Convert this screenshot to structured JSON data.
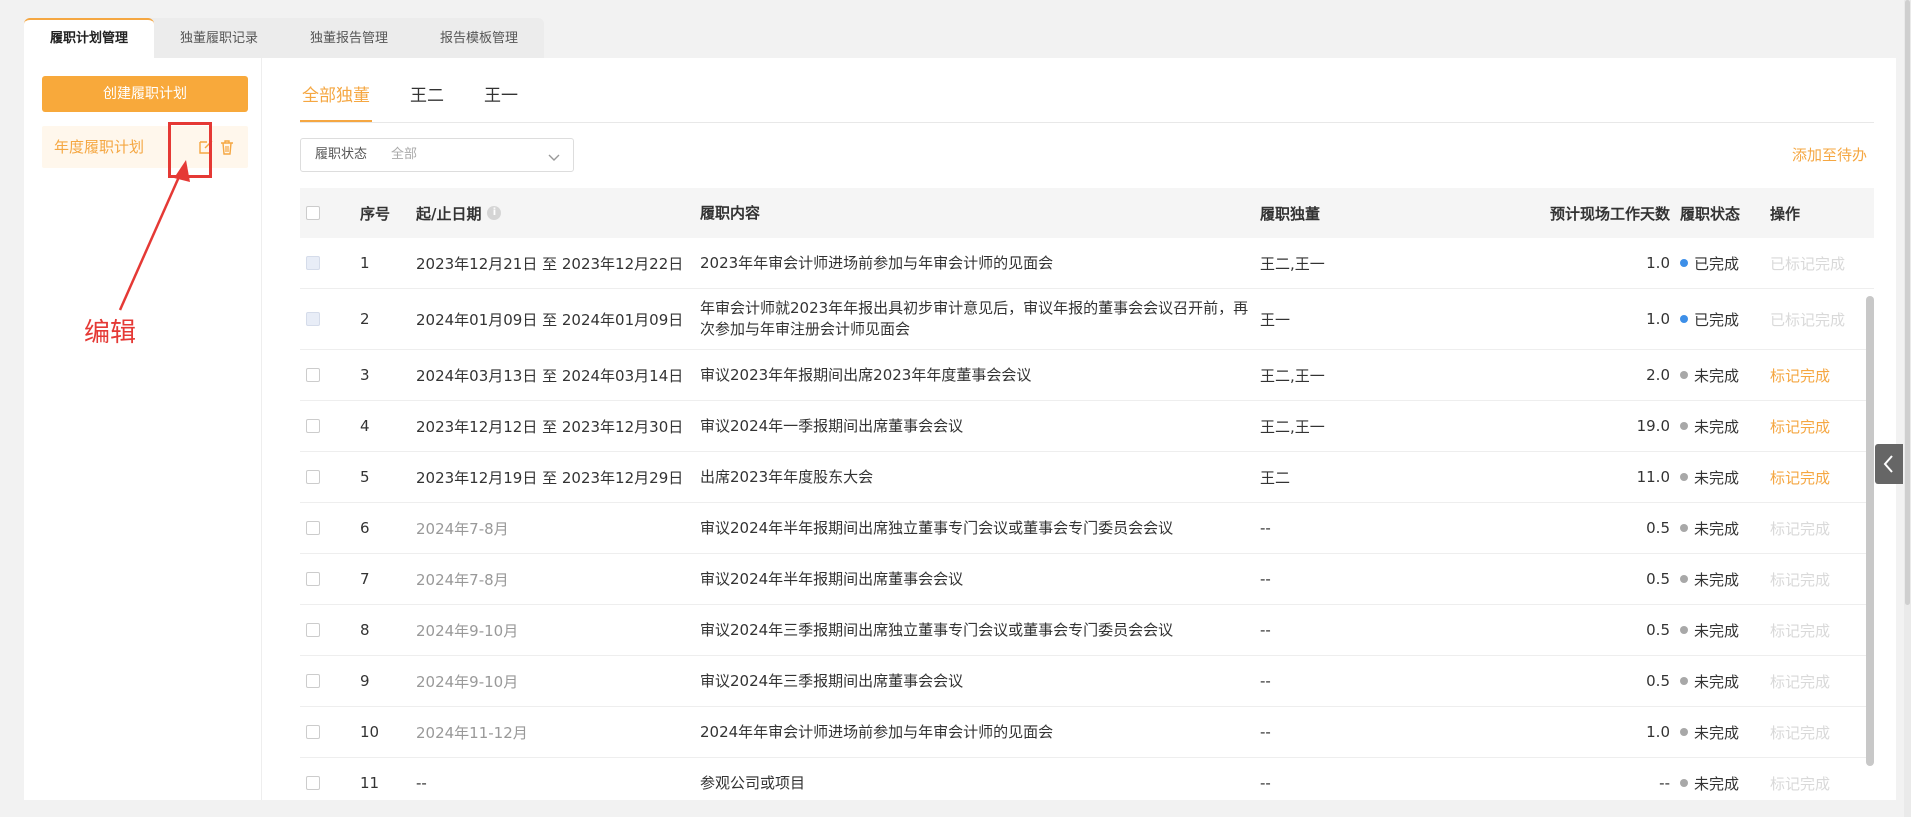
{
  "top_tabs": [
    {
      "label": "履职计划管理",
      "active": true
    },
    {
      "label": "独董履职记录",
      "active": false
    },
    {
      "label": "独董报告管理",
      "active": false
    },
    {
      "label": "报告模板管理",
      "active": false
    }
  ],
  "sidebar": {
    "create_label": "创建履职计划",
    "plan_label": "年度履职计划",
    "edit_icon": "edit-icon",
    "delete_icon": "trash-icon"
  },
  "annotation": {
    "label": "编辑",
    "color": "#e53935"
  },
  "person_tabs": [
    {
      "label": "全部独董",
      "active": true
    },
    {
      "label": "王二",
      "active": false
    },
    {
      "label": "王一",
      "active": false
    }
  ],
  "filter": {
    "label": "履职状态",
    "value": "全部"
  },
  "add_todo_label": "添加至待办",
  "table": {
    "headers": {
      "no": "序号",
      "date": "起/止日期",
      "content": "履职内容",
      "person": "履职独董",
      "days": "预计现场工作天数",
      "status": "履职状态",
      "op": "操作"
    },
    "rows": [
      {
        "no": "1",
        "date": "2023年12月21日 至 2023年12月22日",
        "date_muted": false,
        "content": "2023年年审会计师进场前参加与年审会计师的见面会",
        "person": "王二,王一",
        "days": "1.0",
        "status": "已完成",
        "status_key": "done",
        "op": "已标记完成",
        "op_state": "disabled"
      },
      {
        "no": "2",
        "date": "2024年01月09日 至 2024年01月09日",
        "date_muted": false,
        "content": "年审会计师就2023年年报出具初步审计意见后，审议年报的董事会会议召开前，再次参加与年审注册会计师见面会",
        "person": "王一",
        "days": "1.0",
        "status": "已完成",
        "status_key": "done",
        "op": "已标记完成",
        "op_state": "disabled"
      },
      {
        "no": "3",
        "date": "2024年03月13日 至 2024年03月14日",
        "date_muted": false,
        "content": "审议2023年年报期间出席2023年年度董事会会议",
        "person": "王二,王一",
        "days": "2.0",
        "status": "未完成",
        "status_key": "todo",
        "op": "标记完成",
        "op_state": "active"
      },
      {
        "no": "4",
        "date": "2023年12月12日 至 2023年12月30日",
        "date_muted": false,
        "content": "审议2024年一季报期间出席董事会会议",
        "person": "王二,王一",
        "days": "19.0",
        "status": "未完成",
        "status_key": "todo",
        "op": "标记完成",
        "op_state": "active"
      },
      {
        "no": "5",
        "date": "2023年12月19日 至 2023年12月29日",
        "date_muted": false,
        "content": "出席2023年年度股东大会",
        "person": "王二",
        "days": "11.0",
        "status": "未完成",
        "status_key": "todo",
        "op": "标记完成",
        "op_state": "active"
      },
      {
        "no": "6",
        "date": "2024年7-8月",
        "date_muted": true,
        "content": "审议2024年半年报期间出席独立董事专门会议或董事会专门委员会会议",
        "person": "--",
        "days": "0.5",
        "status": "未完成",
        "status_key": "todo",
        "op": "标记完成",
        "op_state": "disabled"
      },
      {
        "no": "7",
        "date": "2024年7-8月",
        "date_muted": true,
        "content": "审议2024年半年报期间出席董事会会议",
        "person": "--",
        "days": "0.5",
        "status": "未完成",
        "status_key": "todo",
        "op": "标记完成",
        "op_state": "disabled"
      },
      {
        "no": "8",
        "date": "2024年9-10月",
        "date_muted": true,
        "content": "审议2024年三季报期间出席独立董事专门会议或董事会专门委员会会议",
        "person": "--",
        "days": "0.5",
        "status": "未完成",
        "status_key": "todo",
        "op": "标记完成",
        "op_state": "disabled"
      },
      {
        "no": "9",
        "date": "2024年9-10月",
        "date_muted": true,
        "content": "审议2024年三季报期间出席董事会会议",
        "person": "--",
        "days": "0.5",
        "status": "未完成",
        "status_key": "todo",
        "op": "标记完成",
        "op_state": "disabled"
      },
      {
        "no": "10",
        "date": "2024年11-12月",
        "date_muted": true,
        "content": "2024年年审会计师进场前参加与年审会计师的见面会",
        "person": "--",
        "days": "1.0",
        "status": "未完成",
        "status_key": "todo",
        "op": "标记完成",
        "op_state": "disabled"
      },
      {
        "no": "11",
        "date": "--",
        "date_muted": false,
        "content": "参观公司或项目",
        "person": "--",
        "days": "--",
        "status": "未完成",
        "status_key": "todo",
        "op": "标记完成",
        "op_state": "disabled"
      }
    ]
  },
  "colors": {
    "accent": "#f5a742",
    "status_done": "#3d8fe8",
    "status_todo": "#a8a8a8",
    "op_disabled": "#d9d9d9"
  }
}
